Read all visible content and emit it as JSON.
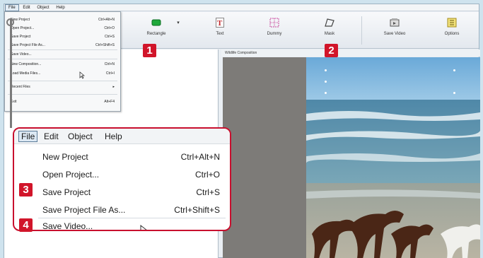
{
  "menubar": {
    "items": [
      "File",
      "Edit",
      "Object",
      "Help"
    ]
  },
  "toolbar": {
    "rectangle": "Rectangle",
    "text": "Text",
    "dummy": "Dummy",
    "mask": "Mask",
    "save_video": "Save Video",
    "options": "Options"
  },
  "composition": {
    "title": "Wildlife Composition"
  },
  "small_menu": {
    "items": [
      {
        "label": "New Project",
        "shortcut": "Ctrl+Alt+N"
      },
      {
        "label": "Open Project...",
        "shortcut": "Ctrl+O"
      },
      {
        "label": "Save Project",
        "shortcut": "Ctrl+S"
      },
      {
        "label": "Save Project File As...",
        "shortcut": "Ctrl+Shift+S"
      },
      {
        "label": "Save Video...",
        "shortcut": ""
      },
      {
        "label": "New Composition...",
        "shortcut": "Ctrl+N"
      },
      {
        "label": "Load Media Files...",
        "shortcut": "Ctrl+I"
      },
      {
        "label": "Recent Files",
        "shortcut": "▸"
      },
      {
        "label": "Exit",
        "shortcut": "Alt+F4"
      }
    ]
  },
  "zoom_menu": {
    "menubar": [
      "File",
      "Edit",
      "Object",
      "Help"
    ],
    "items": [
      {
        "label": "New Project",
        "shortcut": "Ctrl+Alt+N"
      },
      {
        "label": "Open Project...",
        "shortcut": "Ctrl+O"
      },
      {
        "label": "Save Project",
        "shortcut": "Ctrl+S"
      },
      {
        "label": "Save Project File As...",
        "shortcut": "Ctrl+Shift+S"
      },
      {
        "label": "Save Video...",
        "shortcut": ""
      }
    ]
  },
  "badges": [
    "1",
    "2",
    "3",
    "4"
  ],
  "colors": {
    "badge": "#d1152a",
    "highlight_border": "#c8102e"
  }
}
